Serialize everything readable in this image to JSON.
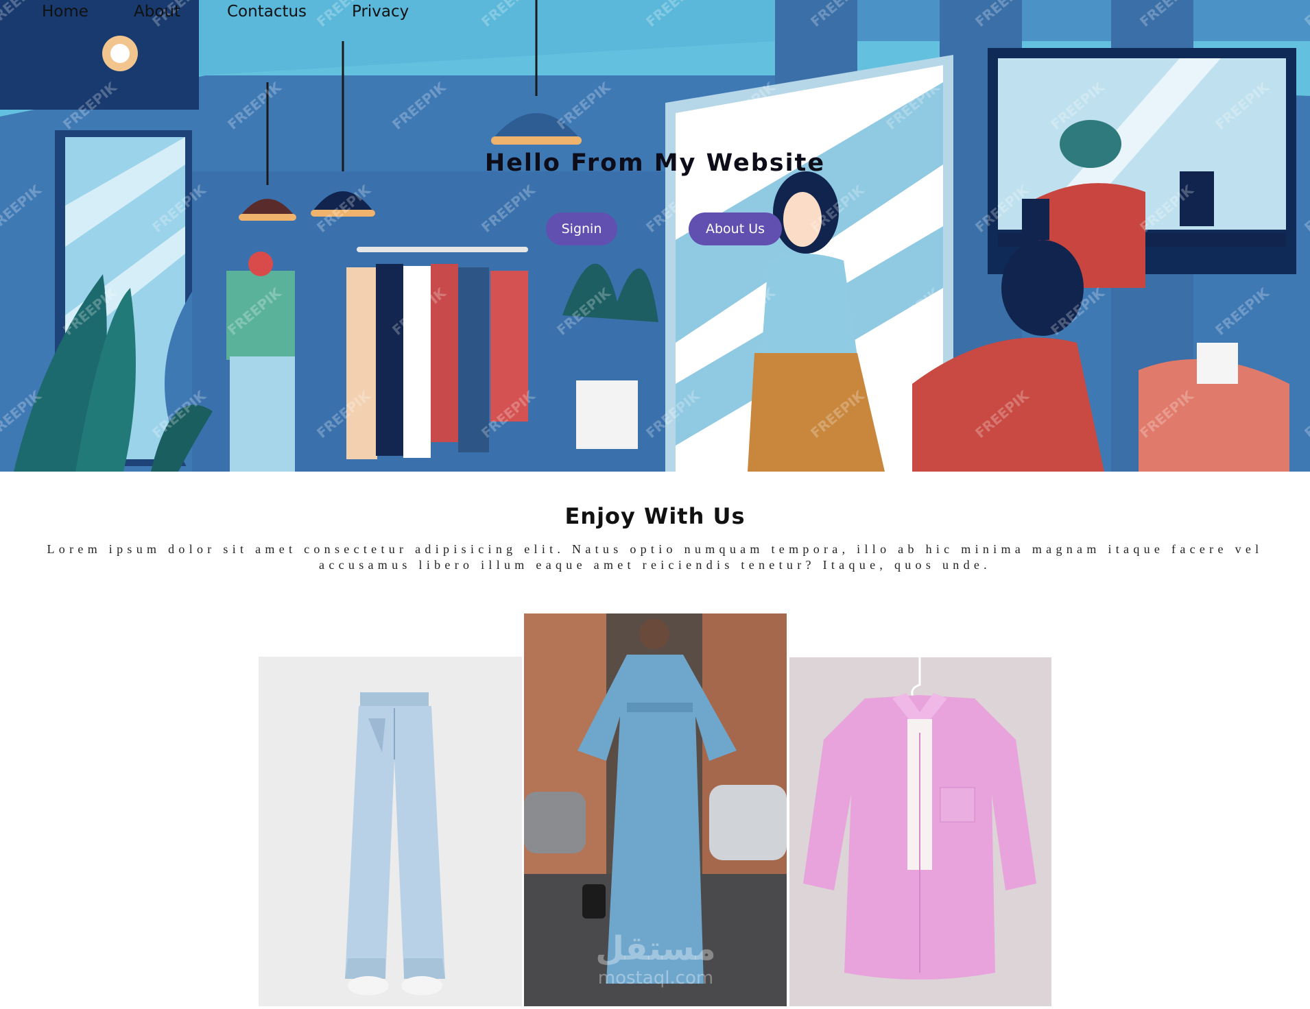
{
  "nav": {
    "items": [
      {
        "label": "Home"
      },
      {
        "label": "About"
      },
      {
        "label": "Contactus"
      },
      {
        "label": "Privacy"
      }
    ]
  },
  "hero": {
    "title": "Hello From My Website",
    "buttons": {
      "signin": "Signin",
      "about": "About Us"
    },
    "watermark": "FREEPIK"
  },
  "section": {
    "title": "Enjoy With Us",
    "text": "Lorem ipsum dolor sit amet consectetur adipisicing elit. Natus optio numquam tempora, illo ab hic minima magnam itaque facere vel accusamus libero illum eaque amet reiciendis tenetur? Itaque, quos unde."
  },
  "products": [
    {
      "name": "jeans"
    },
    {
      "name": "blue-dress"
    },
    {
      "name": "pink-shirt"
    }
  ],
  "watermark_logo": {
    "arabic": "مستقل",
    "latin": "mostaql.com"
  },
  "colors": {
    "button": "#6150b0",
    "hero_blue": "#3f79b4",
    "sky": "#63c0de"
  }
}
